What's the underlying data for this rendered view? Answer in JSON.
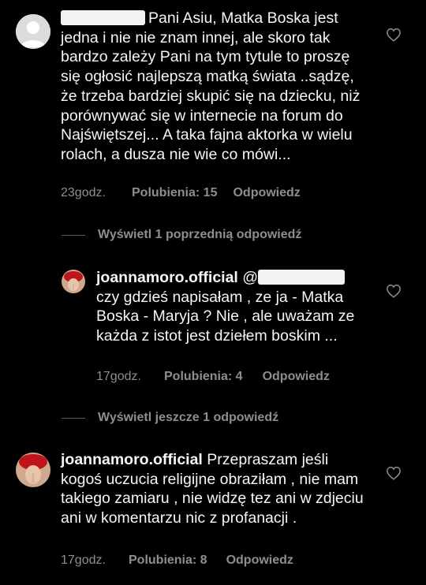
{
  "comments": [
    {
      "username_redacted": true,
      "text": "Pani Asiu, Matka Boska jest jedna i nie nie znam innej, ale skoro tak bardzo zależy Pani na tym tytule to proszę się ogłosić najlepszą matką świata ..sądzę, że trzeba bardziej skupić się na dziecku, niż porównywać się w internecie na forum do Najświętszej... A taka fajna aktorka w wielu rolach, a dusza nie wie co mówi...",
      "time": "23godz.",
      "likes": "Polubienia: 15",
      "reply": "Odpowiedz"
    },
    {
      "username": "joannamoro.official",
      "mention": "@",
      "text": "czy gdzieś napisałam , ze ja - Matka Boska - Maryja ? Nie , ale uważam ze każda z istot jest dziełem boskim ...",
      "time": "17godz.",
      "likes": "Polubienia: 4",
      "reply": "Odpowiedz"
    },
    {
      "username": "joannamoro.official",
      "text": "Przepraszam jeśli kogoś uczucia religijne obraziłam , nie mam takiego zamiaru , nie widzę tez ani w zdjeciu ani w komentarzu nic z profanacji .",
      "time": "17godz.",
      "likes": "Polubienia: 8",
      "reply": "Odpowiedz"
    }
  ],
  "view_previous": "Wyświetl 1 poprzednią odpowiedź",
  "view_more": "Wyświetl jeszcze 1 odpowiedź",
  "colors": {
    "background": "#000000",
    "muted": "#8e8e8e",
    "text": "#f5f5f5"
  },
  "icons": {
    "like": "heart-icon",
    "avatar_default": "default-avatar-icon"
  }
}
